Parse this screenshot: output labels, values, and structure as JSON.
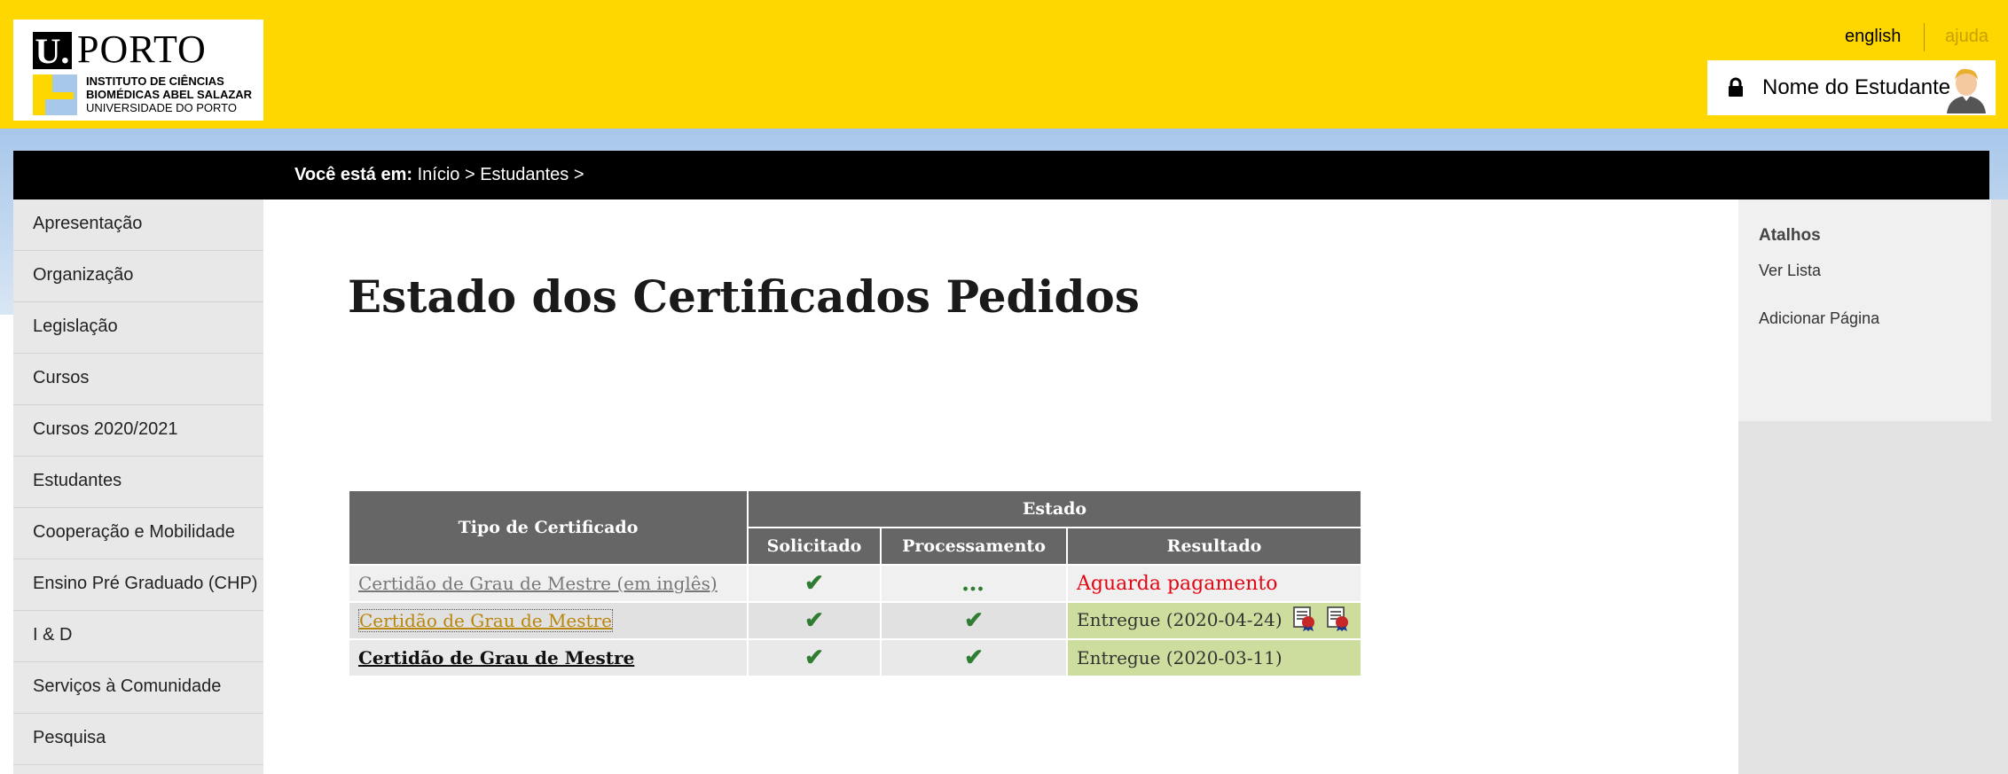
{
  "header": {
    "logo": {
      "mark": "U.",
      "name": "PORTO",
      "institute_line1": "INSTITUTO DE CIÊNCIAS",
      "institute_line2": "BIOMÉDICAS ABEL SALAZAR",
      "university": "UNIVERSIDADE DO PORTO"
    },
    "lang_link": "english",
    "help_link": "ajuda",
    "user_name": "Nome do Estudante"
  },
  "breadcrumb": {
    "prefix": "Você está em:",
    "path": "Início > Estudantes > "
  },
  "sidebar": {
    "items": [
      {
        "label": "Apresentação"
      },
      {
        "label": "Organização"
      },
      {
        "label": "Legislação"
      },
      {
        "label": "Cursos"
      },
      {
        "label": "Cursos 2020/2021"
      },
      {
        "label": "Estudantes"
      },
      {
        "label": "Cooperação e Mobilidade"
      },
      {
        "label": "Ensino Pré Graduado (CHP)"
      },
      {
        "label": "I & D"
      },
      {
        "label": "Serviços à Comunidade"
      },
      {
        "label": "Pesquisa"
      }
    ]
  },
  "main": {
    "title": "Estado dos Certificados Pedidos",
    "table": {
      "headers": {
        "type": "Tipo de Certificado",
        "state": "Estado",
        "requested": "Solicitado",
        "processing": "Processamento",
        "result": "Resultado"
      },
      "rows": [
        {
          "type": "Certidão de Grau de Mestre (em inglês)",
          "requested": "✔",
          "processing": "…",
          "result": "Aguarda pagamento"
        },
        {
          "type": "Certidão de Grau de Mestre",
          "requested": "✔",
          "processing": "✔",
          "result": "Entregue (2020-04-24)"
        },
        {
          "type": "Certidão de Grau de Mestre",
          "requested": "✔",
          "processing": "✔",
          "result": "Entregue (2020-03-11)"
        }
      ]
    }
  },
  "shortcuts": {
    "title": "Atalhos",
    "view_list": "Ver Lista",
    "add_page": "Adicionar Página"
  },
  "colors": {
    "header_bg": "#ffd700",
    "status_wait": "#e30613",
    "status_delivered_bg": "#cddd9d",
    "check_green": "#2e7d32",
    "table_header_bg": "#666666"
  },
  "icons": [
    "lock-icon",
    "user-avatar-icon",
    "certificate-download-icon",
    "check-icon"
  ]
}
